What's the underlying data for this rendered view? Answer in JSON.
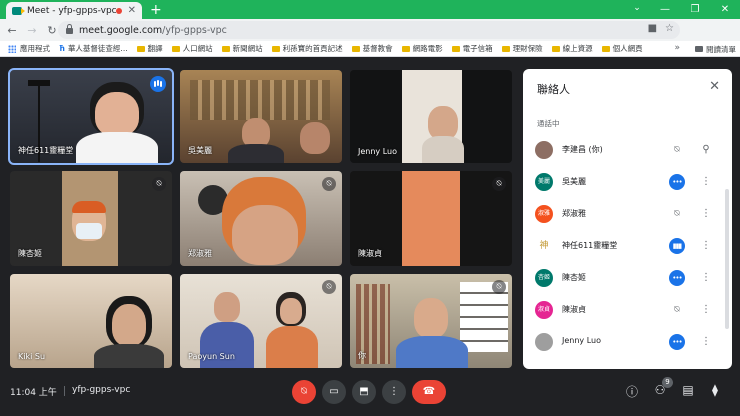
{
  "browser": {
    "tab_title": "Meet - yfp-gpps-vpc",
    "new_tab": "+",
    "url_host": "meet.google.com",
    "url_path": "/yfp-gpps-vpc",
    "bookmarks": [
      "應用程式",
      "華人基督徒查經...",
      "翻譯",
      "人口網站",
      "新聞網站",
      "利孫寶的首頁記述",
      "基督教會",
      "網路電影",
      "電子信箱",
      "理財保險",
      "線上資源",
      "個人網頁"
    ],
    "reading_list": "閱讀清單"
  },
  "meeting": {
    "time": "11:04 上午",
    "code": "yfp-gpps-vpc",
    "participant_count": "9"
  },
  "tiles": [
    {
      "name": "神任611靈糧堂",
      "speaking": true
    },
    {
      "name": "吳美麗"
    },
    {
      "name": "Jenny Luo"
    },
    {
      "name": "陳杏姬",
      "muted": true
    },
    {
      "name": "郑淑雅",
      "muted": true
    },
    {
      "name": "陳淑貞",
      "muted": true
    },
    {
      "name": "Kiki Su"
    },
    {
      "name": "Paoyun Sun",
      "muted": true
    },
    {
      "name": "你",
      "muted": true
    }
  ],
  "panel": {
    "title": "聯絡人",
    "section": "通話中",
    "people": [
      {
        "name": "李建昌 (你)",
        "avatar": "",
        "color": "#8d6e63",
        "status": "muted-pin"
      },
      {
        "name": "吳美麗",
        "avatar": "美麗",
        "color": "#00796b",
        "status": "dots"
      },
      {
        "name": "郑淑雅",
        "avatar": "淑雅",
        "color": "#f4511e",
        "status": "muted"
      },
      {
        "name": "神任611靈糧堂",
        "avatar": "神",
        "color": "#ffffff",
        "status": "speaking"
      },
      {
        "name": "陳杏姬",
        "avatar": "杏姬",
        "color": "#00796b",
        "status": "dots"
      },
      {
        "name": "陳淑貞",
        "avatar": "淑貞",
        "color": "#e52592",
        "status": "muted"
      },
      {
        "name": "Jenny Luo",
        "avatar": "",
        "color": "#9e9e9e",
        "status": "dots"
      }
    ]
  }
}
